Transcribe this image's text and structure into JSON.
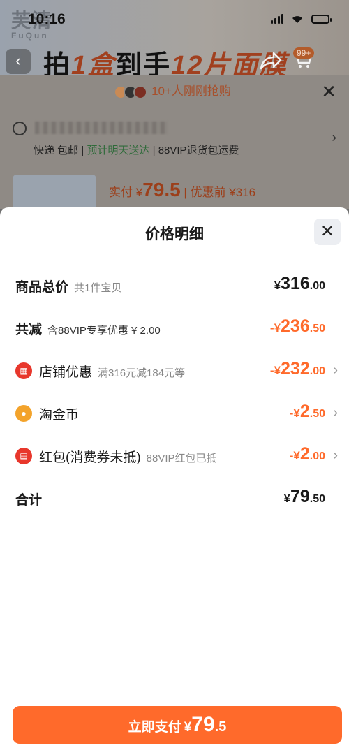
{
  "status_bar": {
    "time": "10:16"
  },
  "background": {
    "brand": "芙清",
    "brand_sub": "FuQun",
    "promo_parts": [
      "拍",
      "1盒",
      "到手",
      "12片",
      "面膜"
    ],
    "cart_badge": "99+",
    "buyers_text": "10+人刚刚抢购",
    "shipping": {
      "courier": "快递 包邮",
      "sep": "|",
      "eta": "预计明天送达",
      "return_policy": "88VIP退货包运费"
    },
    "product_price": {
      "label": "实付 ¥",
      "value": "79.5",
      "sep": "|",
      "before_label": "优惠前 ¥316"
    }
  },
  "sheet": {
    "title": "价格明细",
    "rows": [
      {
        "label": "商品总价",
        "sub": "共1件宝贝",
        "cur": "¥",
        "int": "316",
        "dec": ".00"
      },
      {
        "label": "共减",
        "sub": "含88VIP专享优惠 ¥ 2.00",
        "cur": "-¥",
        "int": "236",
        "dec": ".50"
      },
      {
        "label": "店铺优惠",
        "sub": "满316元减184元等",
        "cur": "-¥",
        "int": "232",
        "dec": ".00",
        "icon": "store-icon"
      },
      {
        "label": "淘金币",
        "sub": "",
        "cur": "-¥",
        "int": "2",
        "dec": ".50",
        "icon": "coin-icon"
      },
      {
        "label": "红包(消费券未抵)",
        "sub": "88VIP红包已抵",
        "cur": "-¥",
        "int": "2",
        "dec": ".00",
        "icon": "red-packet-icon"
      },
      {
        "label": "合计",
        "sub": "",
        "cur": "¥",
        "int": "79",
        "dec": ".50"
      }
    ],
    "pay_button": {
      "label": "立即支付",
      "cur": "¥",
      "int": "79",
      "dec": ".5"
    }
  },
  "colors": {
    "accent": "#ff6a2b",
    "coupon_red": "#e8372c",
    "coin_gold": "#f3a32b"
  }
}
